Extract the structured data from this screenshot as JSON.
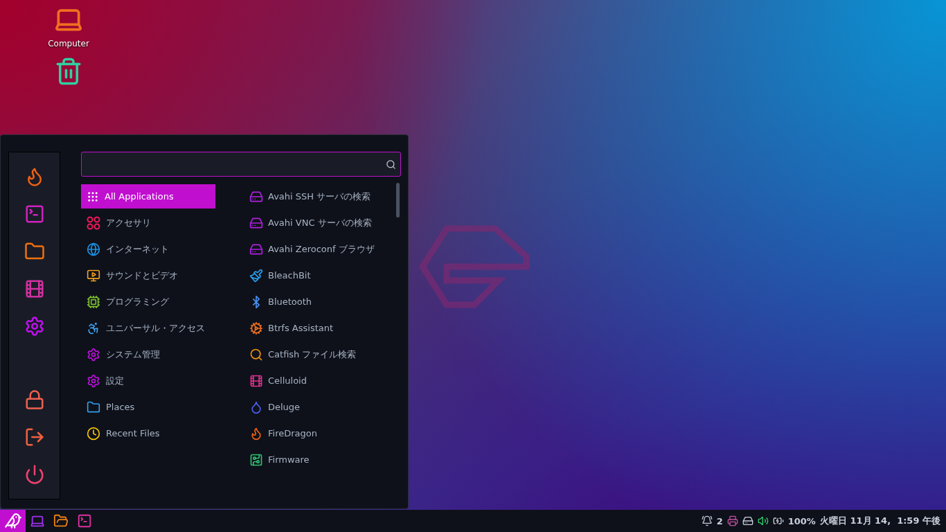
{
  "desktop_icons": [
    {
      "kind": "computer",
      "label": "Computer"
    },
    {
      "kind": "trash"
    }
  ],
  "menu": {
    "categories": [
      {
        "label": "All Applications",
        "selected": true
      },
      {
        "label": "アクセサリ",
        "selected": false
      },
      {
        "label": "インターネット",
        "selected": false
      },
      {
        "label": "サウンドとビデオ",
        "selected": false
      },
      {
        "label": "プログラミング",
        "selected": false
      },
      {
        "label": "ユニバーサル・アクセス",
        "selected": false
      },
      {
        "label": "システム管理",
        "selected": false
      },
      {
        "label": "設定",
        "selected": false
      },
      {
        "label": "Places",
        "selected": false
      },
      {
        "label": "Recent Files",
        "selected": false
      }
    ],
    "apps": [
      "Avahi SSH サーバの検索",
      "Avahi VNC サーバの検索",
      "Avahi Zeroconf ブラウザ",
      "BleachBit",
      "Bluetooth",
      "Btrfs Assistant",
      "Catfish ファイル検索",
      "Celluloid",
      "Deluge",
      "FireDragon",
      "Firmware"
    ]
  },
  "taskbar": {
    "notifications": "2",
    "battery": "100%",
    "clock": "火曜日 11月 14,  1:59 午後"
  }
}
